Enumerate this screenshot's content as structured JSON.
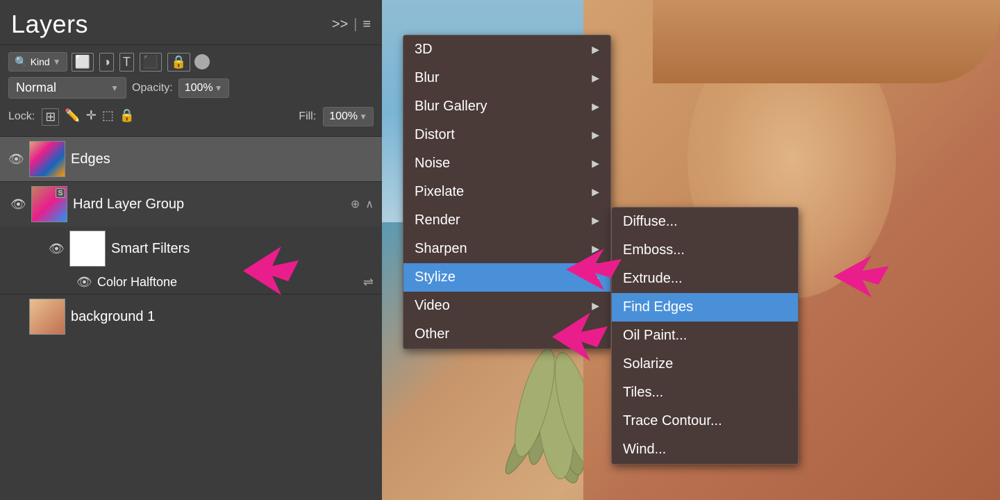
{
  "layers_panel": {
    "title": "Layers",
    "kind_label": "Kind",
    "blend_mode": "Normal",
    "opacity_label": "Opacity:",
    "opacity_value": "100%",
    "fill_label": "Fill:",
    "fill_value": "100%",
    "lock_label": "Lock:",
    "expand_icon": ">>",
    "menu_icon": "≡",
    "layers": [
      {
        "name": "Edges",
        "visible": true,
        "selected": true,
        "type": "layer",
        "thumb_type": "face"
      },
      {
        "name": "Hard Layer Group",
        "visible": true,
        "selected": false,
        "type": "group",
        "thumb_type": "face",
        "expanded": true
      },
      {
        "name": "Smart Filters",
        "visible": true,
        "selected": false,
        "type": "smart_filter",
        "thumb_type": "white",
        "sub": true
      },
      {
        "name": "Color Halftone",
        "visible": true,
        "selected": false,
        "type": "filter_item",
        "sub": true,
        "inner": true
      },
      {
        "name": "background 1",
        "visible": false,
        "selected": false,
        "type": "layer",
        "thumb_type": "face2"
      }
    ]
  },
  "filter_menu": {
    "items": [
      {
        "label": "3D",
        "has_sub": true
      },
      {
        "label": "Blur",
        "has_sub": true
      },
      {
        "label": "Blur Gallery",
        "has_sub": true
      },
      {
        "label": "Distort",
        "has_sub": true
      },
      {
        "label": "Noise",
        "has_sub": true
      },
      {
        "label": "Pixelate",
        "has_sub": true
      },
      {
        "label": "Render",
        "has_sub": true
      },
      {
        "label": "Sharpen",
        "has_sub": true
      },
      {
        "label": "Stylize",
        "has_sub": true,
        "active": true
      },
      {
        "label": "Video",
        "has_sub": true
      },
      {
        "label": "Other",
        "has_sub": true
      }
    ]
  },
  "stylize_submenu": {
    "items": [
      {
        "label": "Diffuse..."
      },
      {
        "label": "Emboss..."
      },
      {
        "label": "Extrude..."
      },
      {
        "label": "Find Edges",
        "active": true
      },
      {
        "label": "Oil Paint..."
      },
      {
        "label": "Solarize"
      },
      {
        "label": "Tiles..."
      },
      {
        "label": "Trace Contour..."
      },
      {
        "label": "Wind..."
      }
    ]
  }
}
